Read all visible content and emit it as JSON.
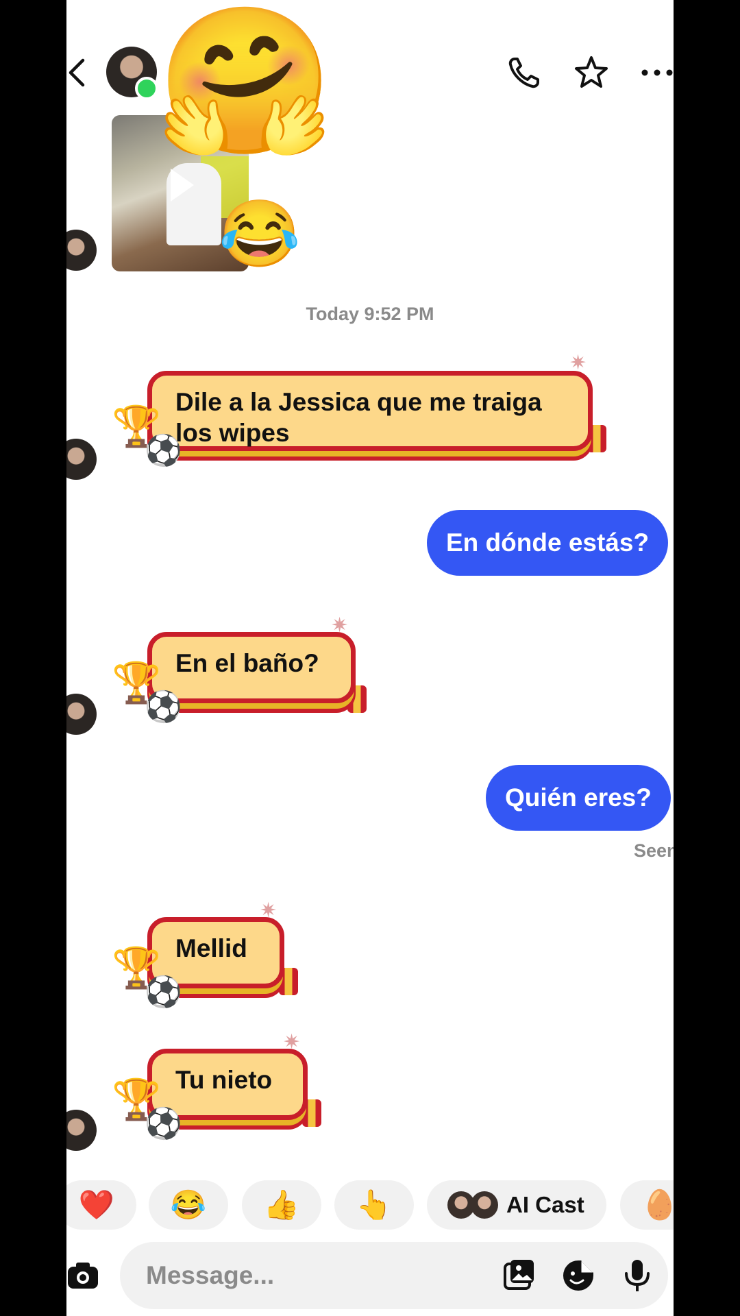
{
  "header": {
    "back_icon": "chevron-left-icon",
    "actions": [
      "phone-icon",
      "star-icon",
      "more-icon"
    ]
  },
  "media": {
    "overlay_emoji": "🤗",
    "reaction_emoji": "😂"
  },
  "timestamp": "Today 9:52 PM",
  "messages": [
    {
      "from": "them",
      "text": "Dile a la Jessica que me traiga los wipes"
    },
    {
      "from": "me",
      "text": "En dónde estás?"
    },
    {
      "from": "them",
      "text": "En el baño?"
    },
    {
      "from": "me",
      "text": "Quién eres?"
    },
    {
      "from": "them",
      "text": "Mellid"
    },
    {
      "from": "them",
      "text": "Tu nieto"
    }
  ],
  "seen_label": "Seen",
  "reactions": [
    {
      "emoji": "❤️"
    },
    {
      "emoji": "😂"
    },
    {
      "emoji": "👍"
    },
    {
      "emoji": "👆"
    },
    {
      "label": "AI Cast"
    },
    {
      "emoji": "🥚"
    }
  ],
  "composer": {
    "placeholder": "Message..."
  },
  "theme": {
    "outgoing_bubble_color": "#3457f4",
    "incoming_bubble_fill": "#fdd88a",
    "incoming_bubble_border": "#c81e2a",
    "online_color": "#2fd35b"
  }
}
